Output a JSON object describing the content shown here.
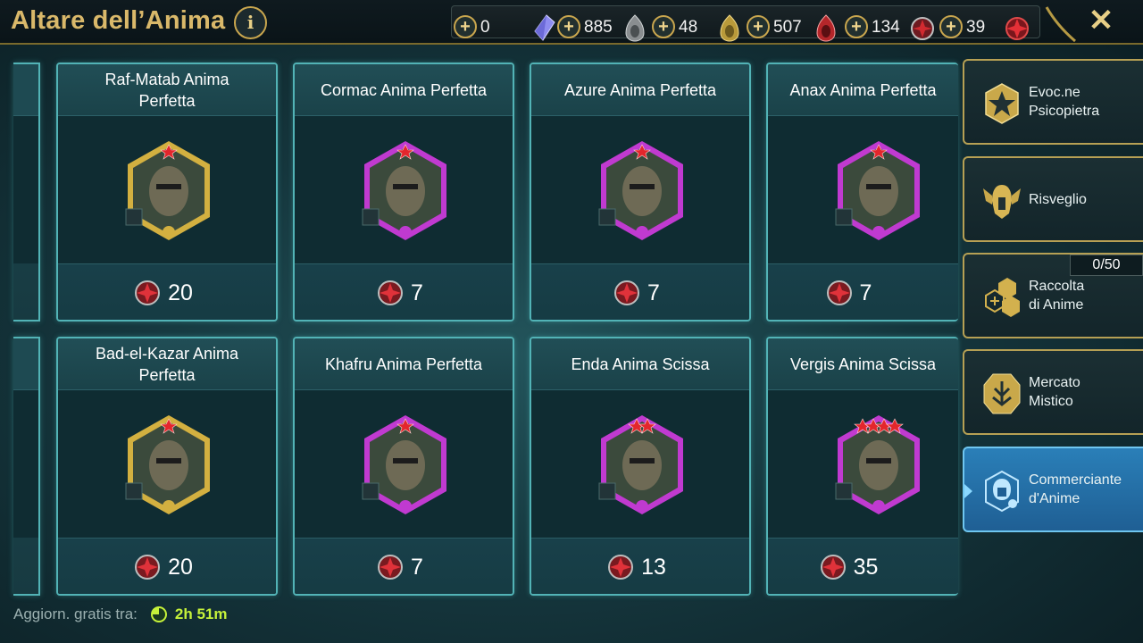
{
  "header": {
    "title": "Altare dell’Anima",
    "info_label": "i",
    "close_label": "✕",
    "resources": [
      {
        "name": "crystal",
        "value": "0",
        "icon": "crystal-icon"
      },
      {
        "name": "common-soul",
        "value": "885",
        "icon": "grey-soul-icon"
      },
      {
        "name": "uncommon-soul",
        "value": "48",
        "icon": "gold-soul-icon"
      },
      {
        "name": "rare-soul",
        "value": "507",
        "icon": "red-soul-icon"
      },
      {
        "name": "epic-soul",
        "value": "134",
        "icon": "dark-soul-icon"
      },
      {
        "name": "legendary-soul",
        "value": "39",
        "icon": "red-soul-orb-icon"
      }
    ]
  },
  "cards": [
    {
      "name": "Raf-Matab Anima\nPerfetta",
      "price": "20",
      "frame": "#d3b040",
      "affinity": "force",
      "stars": 1
    },
    {
      "name": "Cormac Anima Perfetta",
      "price": "7",
      "frame": "#c03ad0",
      "affinity": "spirit",
      "stars": 1
    },
    {
      "name": "Azure Anima Perfetta",
      "price": "7",
      "frame": "#c03ad0",
      "affinity": "spirit",
      "stars": 1
    },
    {
      "name": "Anax Anima Perfetta",
      "price": "7",
      "frame": "#c03ad0",
      "affinity": "spirit",
      "stars": 1
    },
    {
      "name": "Bad-el-Kazar Anima\nPerfetta",
      "price": "20",
      "frame": "#d3b040",
      "affinity": "spirit",
      "stars": 1
    },
    {
      "name": "Khafru Anima Perfetta",
      "price": "7",
      "frame": "#c03ad0",
      "affinity": "spirit",
      "stars": 1
    },
    {
      "name": "Enda Anima Scissa",
      "price": "13",
      "frame": "#c03ad0",
      "affinity": "spirit",
      "stars": 2
    },
    {
      "name": "Vergis Anima Scissa",
      "price": "35",
      "frame": "#c03ad0",
      "affinity": "magic",
      "stars": 4
    }
  ],
  "menu": [
    {
      "label": "Evoc.ne\nPsicopietra",
      "icon": "star-badge-icon",
      "active": false
    },
    {
      "label": "Risveglio",
      "icon": "winged-helmet-icon",
      "active": false
    },
    {
      "label": "Raccolta\ndi Anime",
      "icon": "soul-collection-icon",
      "active": false
    },
    {
      "label": "Mercato\nMistico",
      "icon": "mystic-market-icon",
      "active": false
    },
    {
      "label": "Commerciante\nd'Anime",
      "icon": "soul-merchant-icon",
      "active": true
    }
  ],
  "collection_counter": "0/50",
  "footer": {
    "refresh_label": "Aggiorn. gratis tra:",
    "timer": "2h 51m"
  },
  "colors": {
    "title_gold": "#d9b86a",
    "card_border": "#52b3b6",
    "timer_green": "#c6f23a",
    "active_menu": "#2a7fb8"
  }
}
